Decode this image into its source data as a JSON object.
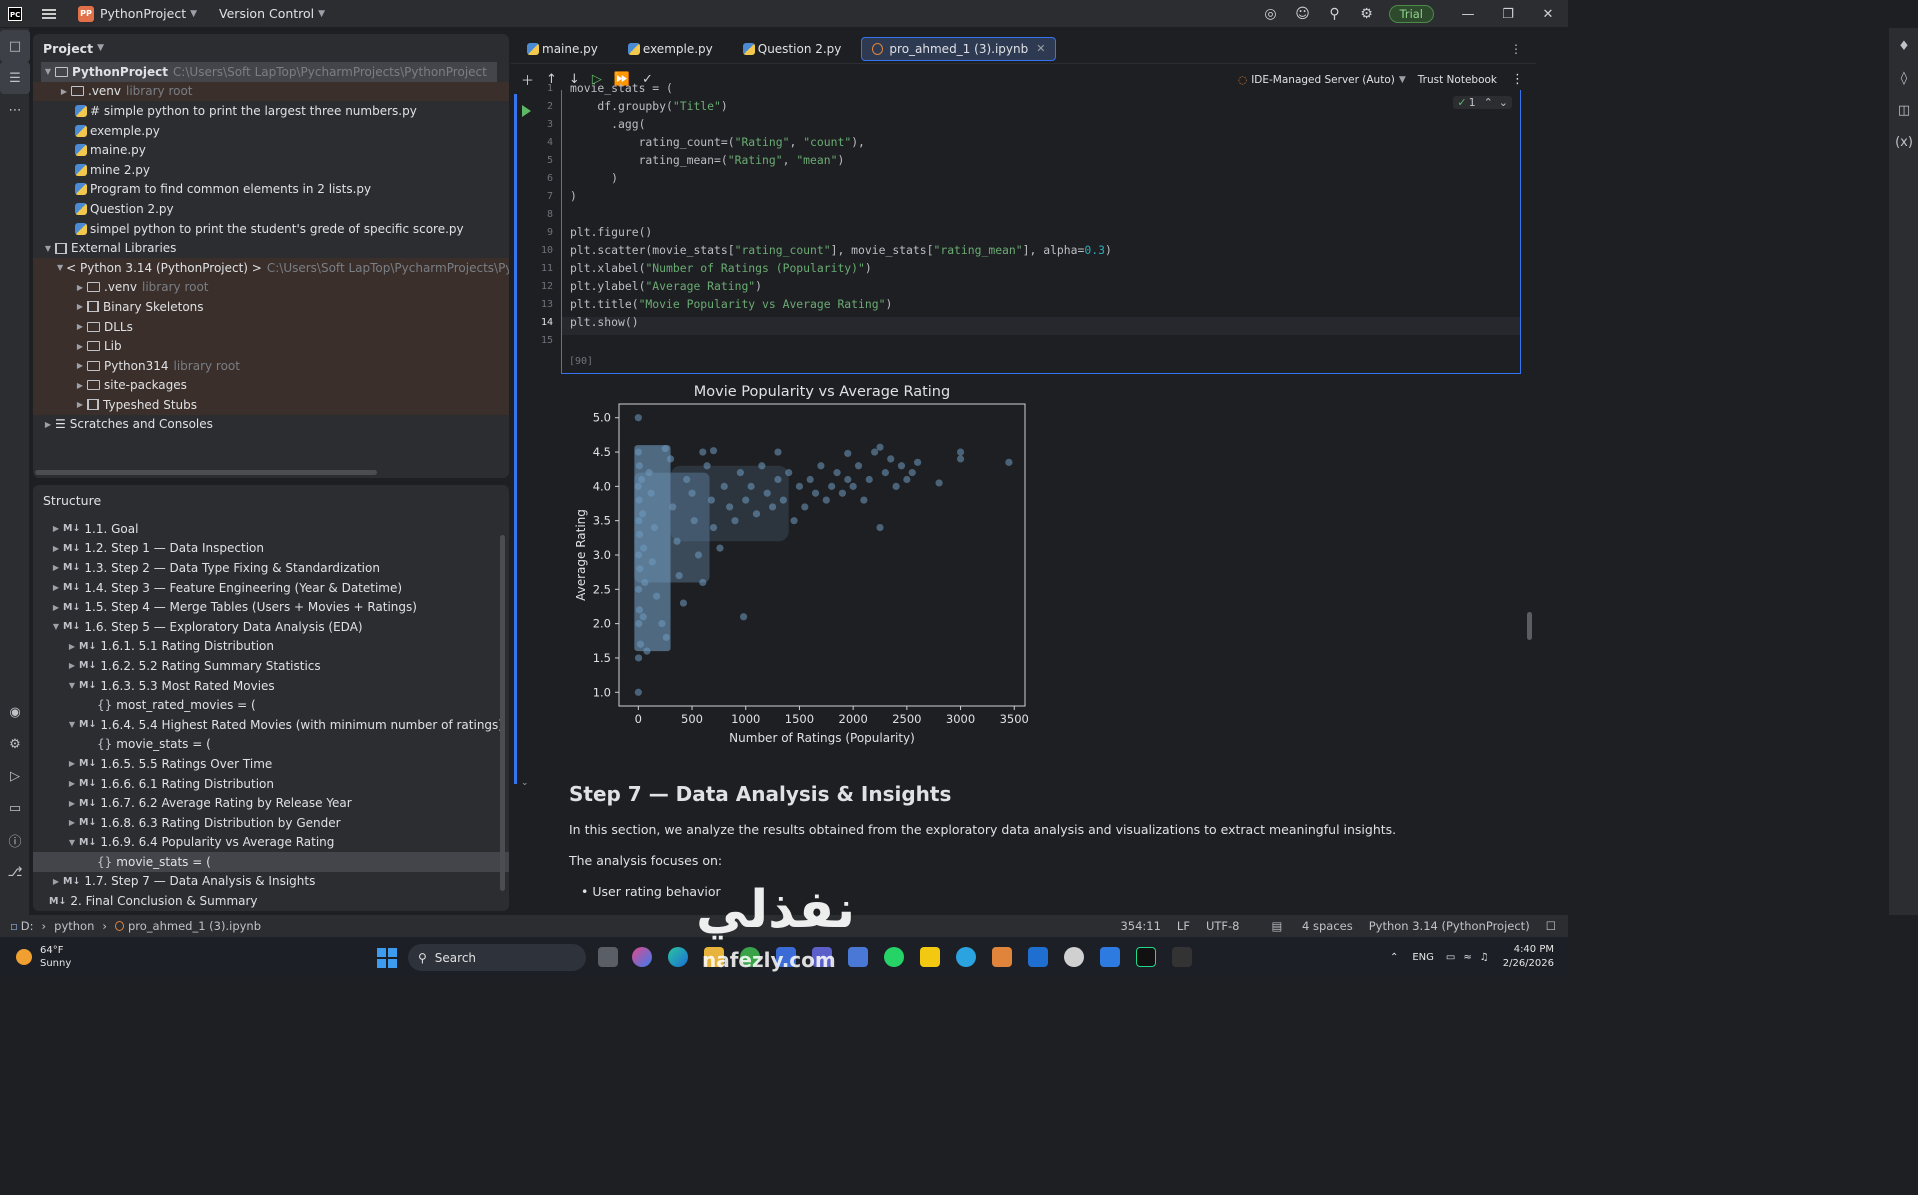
{
  "titlebar": {
    "project_badge": "PP",
    "project_name": "PythonProject",
    "vcs": "Version Control",
    "trial": "Trial"
  },
  "tabs": [
    {
      "label": "maine.py"
    },
    {
      "label": "exemple.py"
    },
    {
      "label": "Question 2.py"
    },
    {
      "label": "pro_ahmed_1 (3).ipynb",
      "active": true
    }
  ],
  "toolbar": {
    "server": "IDE-Managed Server (Auto)",
    "trust": "Trust Notebook",
    "inspections": "1"
  },
  "project_panel": {
    "title": "Project",
    "root": "PythonProject",
    "root_path": "C:\\Users\\Soft LapTop\\PycharmProjects\\PythonProject",
    "venv": ".venv",
    "library_root": "library root",
    "files": [
      "# simple python to print the largest three numbers.py",
      "exemple.py",
      "maine.py",
      "mine 2.py",
      "Program to find common elements in 2 lists.py",
      "Question 2.py",
      "simpel python to print the student's grede of specific score.py"
    ],
    "external": "External Libraries",
    "python": "< Python 3.14 (PythonProject) >",
    "python_path": "C:\\Users\\Soft LapTop\\PycharmProjects\\PythonP",
    "libs": [
      ".venv",
      "Binary Skeletons",
      "DLLs",
      "Lib",
      "Python314",
      "site-packages",
      "Typeshed Stubs"
    ],
    "scratches": "Scratches and Consoles"
  },
  "structure_panel": {
    "title": "Structure",
    "md_badge": "M↓",
    "items": [
      "1.1. Goal",
      "1.2. Step 1 — Data Inspection",
      "1.3. Step 2 — Data Type Fixing & Standardization",
      "1.4. Step 3 — Feature Engineering (Year & Datetime)",
      "1.5. Step 4 — Merge Tables (Users + Movies + Ratings)",
      "1.6. Step 5 — Exploratory Data Analysis (EDA)",
      "1.6.1. 5.1 Rating Distribution",
      "1.6.2. 5.2 Rating Summary Statistics",
      "1.6.3. 5.3 Most Rated Movies",
      "most_rated_movies = (",
      "1.6.4. 5.4 Highest Rated Movies (with minimum number of ratings)",
      "movie_stats = (",
      "1.6.5. 5.5 Ratings Over Time",
      "1.6.6. 6.1 Rating Distribution",
      "1.6.7. 6.2 Average Rating by Release Year",
      "1.6.8. 6.3 Rating Distribution by Gender",
      "1.6.9. 6.4 Popularity vs Average Rating",
      "movie_stats = (",
      "1.7. Step 7 — Data Analysis & Insights",
      "2. Final Conclusion & Summary"
    ]
  },
  "code": {
    "line_numbers": [
      "1",
      "2",
      "3",
      "4",
      "5",
      "6",
      "7",
      "8",
      "9",
      "10",
      "11",
      "12",
      "13",
      "14",
      "15"
    ],
    "lines": [
      "movie_stats = (",
      "    df.groupby(\"Title\")",
      "      .agg(",
      "          rating_count=(\"Rating\", \"count\"),",
      "          rating_mean=(\"Rating\", \"mean\")",
      "      )",
      ")",
      "",
      "plt.figure()",
      "plt.scatter(movie_stats[\"rating_count\"], movie_stats[\"rating_mean\"], alpha=0.3)",
      "plt.xlabel(\"Number of Ratings (Popularity)\")",
      "plt.ylabel(\"Average Rating\")",
      "plt.title(\"Movie Popularity vs Average Rating\")",
      "plt.show()",
      ""
    ],
    "exec_count": "[90]"
  },
  "chart_data": {
    "type": "scatter",
    "title": "Movie Popularity vs Average Rating",
    "xlabel": "Number of Ratings (Popularity)",
    "ylabel": "Average Rating",
    "xlim": [
      -180,
      3600
    ],
    "ylim": [
      0.8,
      5.2
    ],
    "xticks": [
      "0",
      "500",
      "1000",
      "1500",
      "2000",
      "2500",
      "3000",
      "3500"
    ],
    "yticks": [
      "1.0",
      "1.5",
      "2.0",
      "2.5",
      "3.0",
      "3.5",
      "4.0",
      "4.5",
      "5.0"
    ],
    "color": "#6f9bc0",
    "points": [
      [
        0,
        5.0
      ],
      [
        0,
        1.0
      ],
      [
        0,
        4.5
      ],
      [
        0,
        4.0
      ],
      [
        5,
        3.5
      ],
      [
        3,
        3.0
      ],
      [
        2,
        2.5
      ],
      [
        4,
        2.0
      ],
      [
        2,
        1.5
      ],
      [
        10,
        4.3
      ],
      [
        8,
        3.8
      ],
      [
        12,
        3.3
      ],
      [
        15,
        2.8
      ],
      [
        10,
        2.2
      ],
      [
        20,
        1.7
      ],
      [
        30,
        4.1
      ],
      [
        40,
        3.6
      ],
      [
        50,
        3.1
      ],
      [
        60,
        2.6
      ],
      [
        45,
        2.1
      ],
      [
        80,
        1.6
      ],
      [
        100,
        4.2
      ],
      [
        120,
        3.9
      ],
      [
        150,
        3.4
      ],
      [
        130,
        2.9
      ],
      [
        170,
        2.4
      ],
      [
        220,
        2.0
      ],
      [
        260,
        1.8
      ],
      [
        300,
        4.4
      ],
      [
        320,
        3.7
      ],
      [
        360,
        3.2
      ],
      [
        380,
        2.7
      ],
      [
        420,
        2.3
      ],
      [
        450,
        4.1
      ],
      [
        500,
        3.9
      ],
      [
        520,
        3.5
      ],
      [
        560,
        3.0
      ],
      [
        600,
        2.6
      ],
      [
        640,
        4.3
      ],
      [
        680,
        3.8
      ],
      [
        700,
        3.4
      ],
      [
        760,
        3.1
      ],
      [
        800,
        4.0
      ],
      [
        850,
        3.7
      ],
      [
        900,
        3.5
      ],
      [
        950,
        4.2
      ],
      [
        980,
        2.1
      ],
      [
        1000,
        3.8
      ],
      [
        1050,
        4.0
      ],
      [
        1100,
        3.6
      ],
      [
        1150,
        4.3
      ],
      [
        1200,
        3.9
      ],
      [
        1250,
        3.7
      ],
      [
        1300,
        4.1
      ],
      [
        1350,
        3.8
      ],
      [
        1400,
        4.2
      ],
      [
        1450,
        3.5
      ],
      [
        1500,
        4.0
      ],
      [
        1550,
        3.7
      ],
      [
        1600,
        4.1
      ],
      [
        1650,
        3.9
      ],
      [
        1700,
        4.3
      ],
      [
        1750,
        3.8
      ],
      [
        1800,
        4.0
      ],
      [
        1850,
        4.2
      ],
      [
        1900,
        3.9
      ],
      [
        1950,
        4.1
      ],
      [
        2000,
        4.0
      ],
      [
        2050,
        4.3
      ],
      [
        2100,
        3.8
      ],
      [
        2150,
        4.1
      ],
      [
        2200,
        4.5
      ],
      [
        2250,
        3.4
      ],
      [
        2300,
        4.2
      ],
      [
        2350,
        4.4
      ],
      [
        2400,
        4.0
      ],
      [
        2450,
        4.3
      ],
      [
        2500,
        4.1
      ],
      [
        2550,
        4.2
      ],
      [
        2600,
        4.35
      ],
      [
        2800,
        4.05
      ],
      [
        3000,
        4.4
      ],
      [
        3000,
        4.5
      ],
      [
        3450,
        4.35
      ],
      [
        250,
        4.55
      ],
      [
        600,
        4.5
      ],
      [
        700,
        4.52
      ],
      [
        1300,
        4.5
      ],
      [
        1950,
        4.48
      ],
      [
        2250,
        4.57
      ]
    ]
  },
  "markdown": {
    "title": "Step 7 — Data Analysis & Insights",
    "p1": "In this section, we analyze the results obtained from the exploratory data analysis and visualizations to extract meaningful insights.",
    "p2": "The analysis focuses on:",
    "li1": "User rating behavior"
  },
  "statusbar": {
    "drive": "D:",
    "python": "python",
    "file": "pro_ahmed_1 (3).ipynb",
    "pos": "354:11",
    "lf": "LF",
    "enc": "UTF-8",
    "indent": "4 spaces",
    "interp": "Python 3.14 (PythonProject)"
  },
  "taskbar": {
    "temp": "64°F",
    "weather": "Sunny",
    "search": "Search",
    "lang": "ENG",
    "time": "4:40 PM",
    "date": "2/26/2026"
  },
  "watermark": {
    "arabic": "نفذلي",
    "latin": "nafezly.com"
  }
}
